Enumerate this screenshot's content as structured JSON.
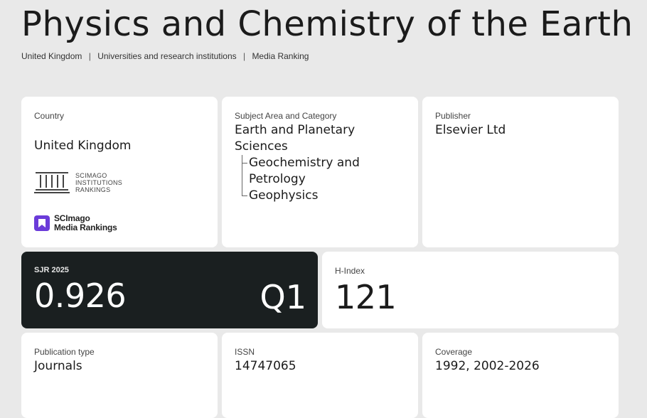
{
  "page": {
    "title": "Physics and Chemistry of the Earth"
  },
  "breadcrumb": {
    "items": [
      "United Kingdom",
      "Universities and research institutions",
      "Media Ranking"
    ],
    "separator": "|"
  },
  "country_card": {
    "label": "Country",
    "value": "United Kingdom",
    "sir_logo_text": [
      "SCIMAGO",
      "INSTITUTIONS",
      "RANKINGS"
    ],
    "smr_logo_text": [
      "SCImago",
      "Media Rankings"
    ]
  },
  "subject_card": {
    "label": "Subject Area and Category",
    "area": "Earth and Planetary Sciences",
    "categories": [
      "Geochemistry and Petrology",
      "Geophysics"
    ]
  },
  "publisher_card": {
    "label": "Publisher",
    "value": "Elsevier Ltd"
  },
  "sjr_card": {
    "label": "SJR 2025",
    "value": "0.926",
    "quartile": "Q1",
    "background_color": "#1a1f20"
  },
  "hindex_card": {
    "label": "H-Index",
    "value": "121"
  },
  "pubtype_card": {
    "label": "Publication type",
    "value": "Journals"
  },
  "issn_card": {
    "label": "ISSN",
    "value": "14747065"
  },
  "coverage_card": {
    "label": "Coverage",
    "value": "1992, 2002-2026"
  },
  "colors": {
    "page_background": "#e9e9e9",
    "card_background": "#ffffff",
    "smr_brand": "#6b3bd9"
  }
}
